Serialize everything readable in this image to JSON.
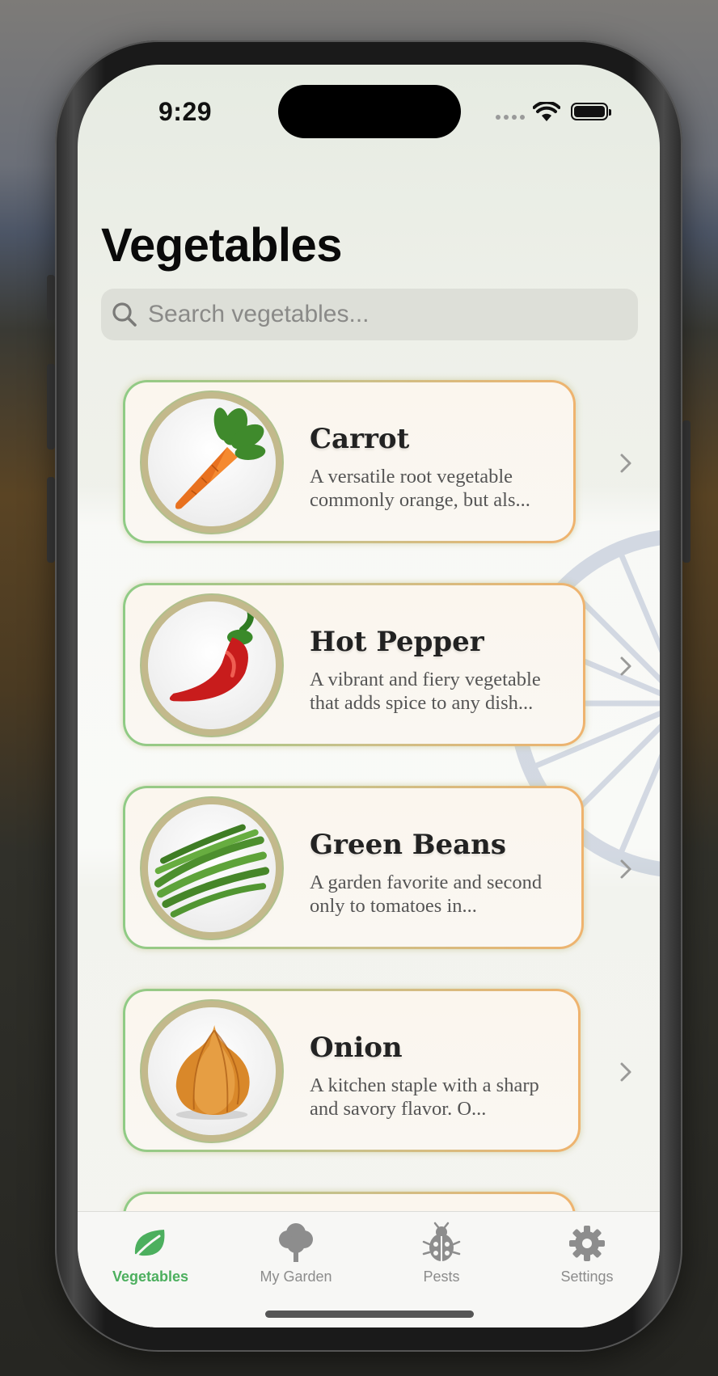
{
  "status_bar": {
    "time": "9:29"
  },
  "header": {
    "title": "Vegetables"
  },
  "search": {
    "placeholder": "Search vegetables..."
  },
  "vegetables": [
    {
      "name": "Carrot",
      "description": "A versatile root vegetable commonly orange, but als..."
    },
    {
      "name": "Hot Pepper",
      "description": "A vibrant and fiery vegetable that adds spice to any dish..."
    },
    {
      "name": "Green Beans",
      "description": "A garden favorite and second only to tomatoes in..."
    },
    {
      "name": "Onion",
      "description": "A kitchen staple with a sharp and savory flavor. O..."
    }
  ],
  "tabs": [
    {
      "label": "Vegetables",
      "icon": "leaf-icon",
      "active": true
    },
    {
      "label": "My Garden",
      "icon": "tree-icon",
      "active": false
    },
    {
      "label": "Pests",
      "icon": "ladybug-icon",
      "active": false
    },
    {
      "label": "Settings",
      "icon": "gear-icon",
      "active": false
    }
  ],
  "colors": {
    "accent": "#4caf5e",
    "card_border_start": "#8fcb85",
    "card_border_end": "#efb36e"
  }
}
